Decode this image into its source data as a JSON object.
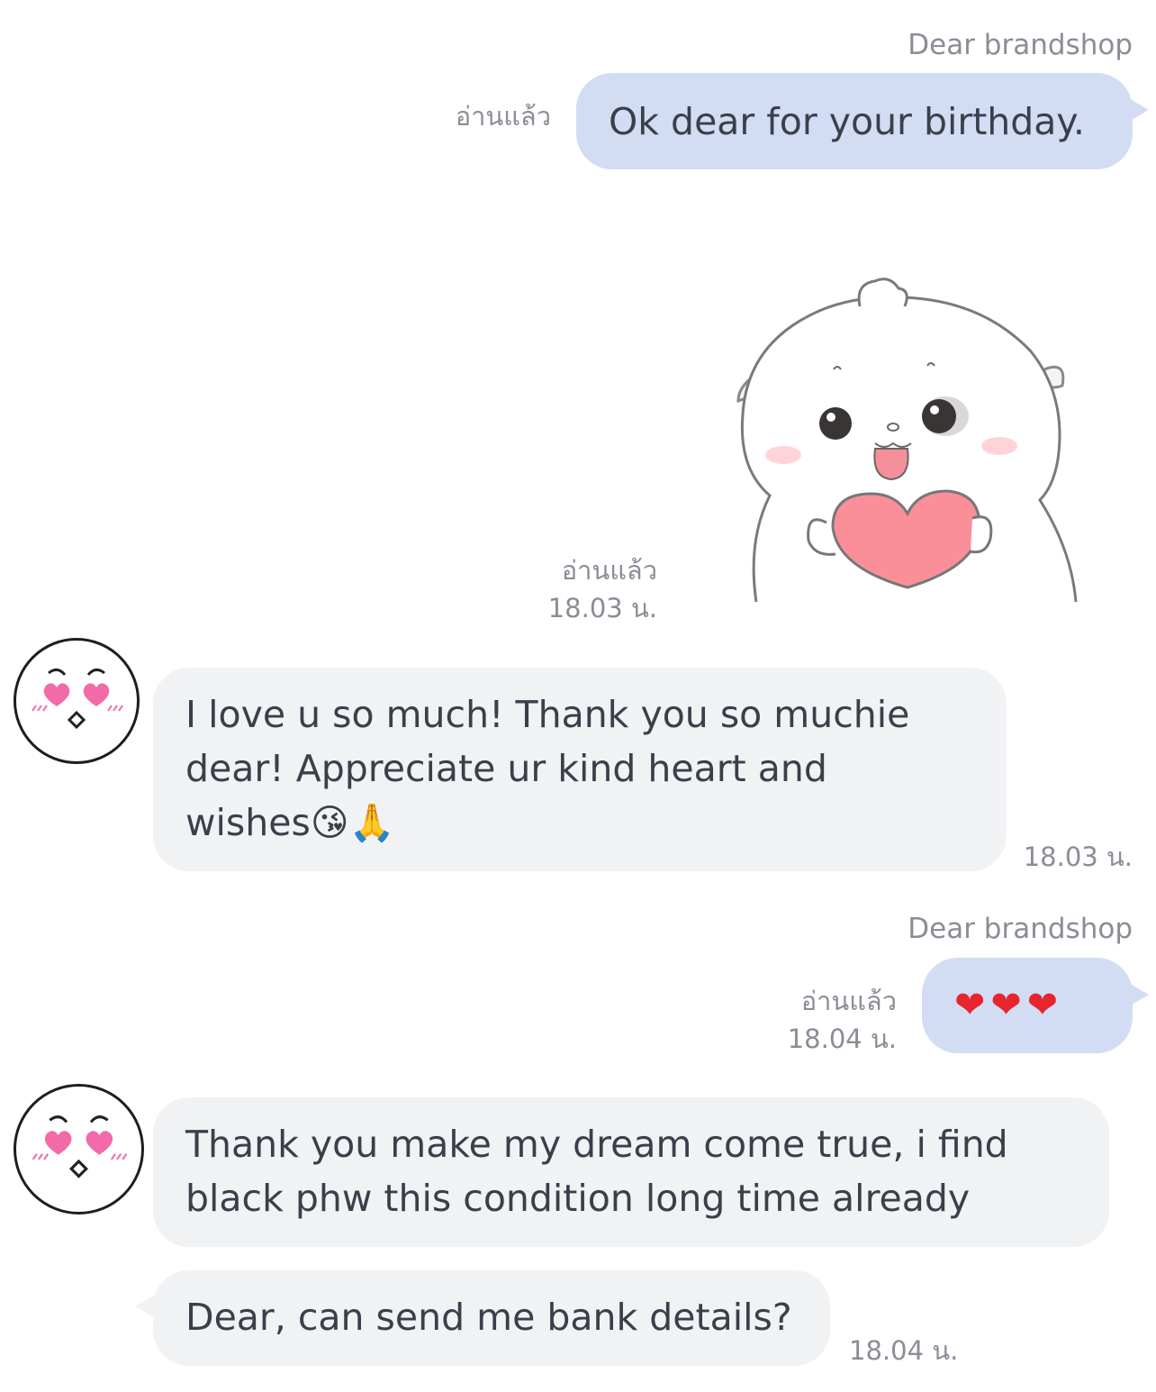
{
  "messages": {
    "m1": {
      "sender": "Dear brandshop",
      "status": "อ่านแล้ว",
      "text": "Ok dear for your birthday."
    },
    "m2": {
      "status": "อ่านแล้ว",
      "time": "18.03 น.",
      "sticker": "white-bear-holding-heart-sticker"
    },
    "m3": {
      "line1": "I love u so much! Thank you so muchie",
      "line2": "dear! Appreciate ur kind heart and",
      "line3": "wishes😘🙏",
      "time": "18.03 น."
    },
    "m4": {
      "sender": "Dear brandshop",
      "status": "อ่านแล้ว",
      "time": "18.04 น.",
      "text": "❤❤❤"
    },
    "m5": {
      "line1": "Thank you make my dream come true, i find",
      "line2": "black phw this condition long time already"
    },
    "m6": {
      "text": "Dear, can send me bank details?",
      "time": "18.04 น."
    }
  },
  "colors": {
    "outgoing_bubble": "#d2ddf4",
    "incoming_bubble": "#f1f2f4",
    "meta_text": "#8a8d96"
  }
}
